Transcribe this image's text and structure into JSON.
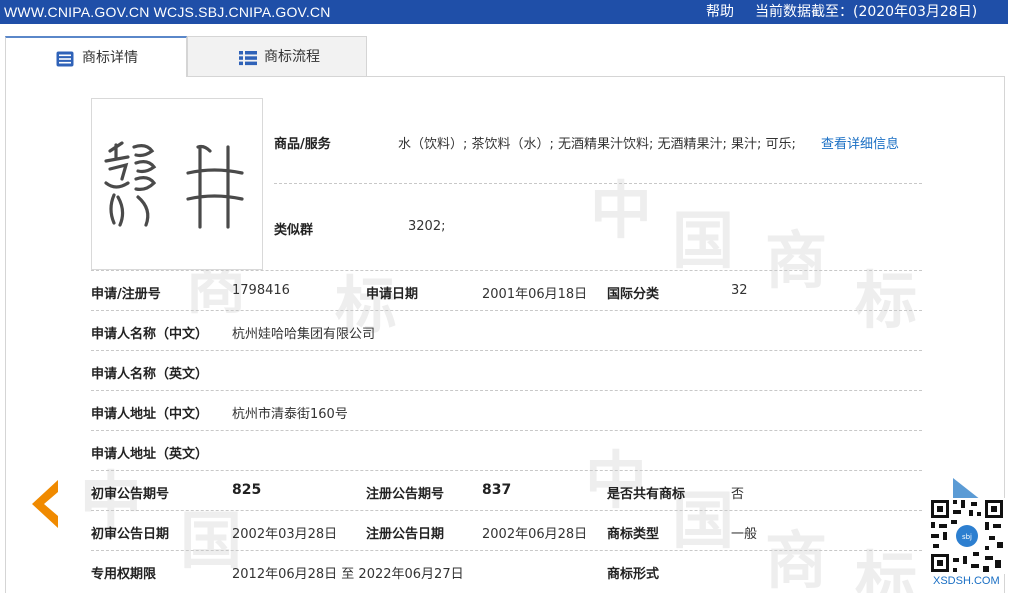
{
  "topbar": {
    "sites": "WWW.CNIPA.GOV.CN WCJS.SBJ.CNIPA.GOV.CN",
    "help": "帮助",
    "date_label": "当前数据截至：(2020年03月28日)"
  },
  "tabs": [
    {
      "label": "商标详情",
      "icon": "document-list-icon",
      "active": true
    },
    {
      "label": "商标流程",
      "icon": "grid-list-icon",
      "active": false
    }
  ],
  "trademark": {
    "logo_glyphs": "龍 井",
    "goods_label": "商品/服务",
    "goods_value": "水（饮料）; 茶饮料（水）; 无酒精果汁饮料; 无酒精果汁; 果汁; 可乐;",
    "goods_link": "查看详细信息",
    "similar_label": "类似群",
    "similar_value": "3202;"
  },
  "details": {
    "reg_no_label": "申请/注册号",
    "reg_no": "1798416",
    "app_date_label": "申请日期",
    "app_date": "2001年06月18日",
    "intl_class_label": "国际分类",
    "intl_class": "32",
    "applicant_cn_label": "申请人名称（中文）",
    "applicant_cn": "杭州娃哈哈集团有限公司",
    "applicant_en_label": "申请人名称（英文）",
    "applicant_en": "",
    "address_cn_label": "申请人地址（中文）",
    "address_cn": "杭州市清泰街160号",
    "address_en_label": "申请人地址（英文）",
    "address_en": "",
    "prelim_no_label": "初审公告期号",
    "prelim_no": "825",
    "reg_pub_no_label": "注册公告期号",
    "reg_pub_no": "837",
    "shared_label": "是否共有商标",
    "shared": "否",
    "prelim_date_label": "初审公告日期",
    "prelim_date": "2002年03月28日",
    "reg_pub_date_label": "注册公告日期",
    "reg_pub_date": "2002年06月28日",
    "type_label": "商标类型",
    "type": "一般",
    "period_label": "专用权期限",
    "period": "2012年06月28日 至 2022年06月27日",
    "form_label": "商标形式",
    "form": ""
  },
  "watermark": {
    "chars": [
      "中",
      "国",
      "商",
      "标"
    ]
  },
  "side": {
    "qr_caption": "XSDSH.COM"
  },
  "colors": {
    "topbar": "#1f4fa8",
    "accent_orange": "#f08a00",
    "link": "#1a6fc4"
  }
}
